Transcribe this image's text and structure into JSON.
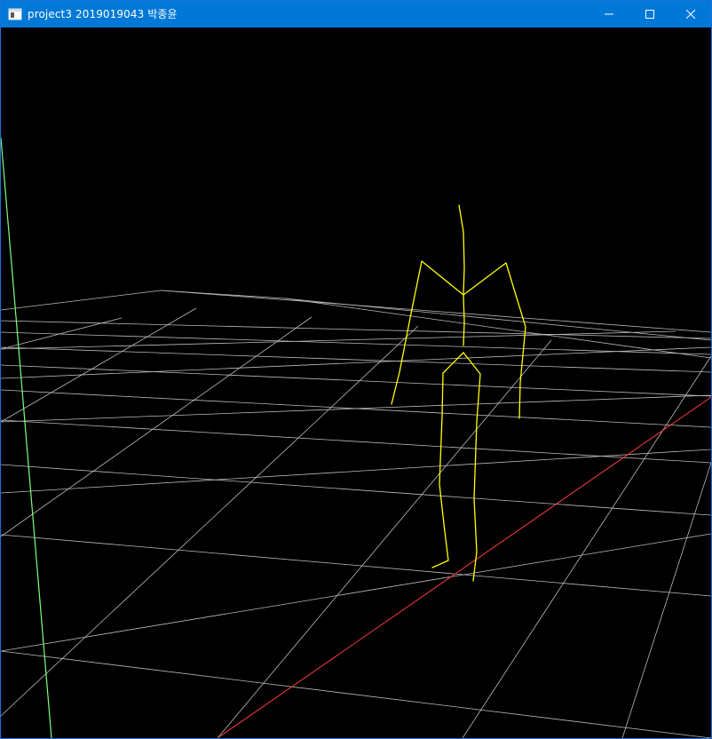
{
  "window": {
    "title": "project3 2019019043 박종윤",
    "controls": {
      "minimize_icon": "minimize-icon",
      "maximize_icon": "maximize-icon",
      "close_icon": "close-icon"
    },
    "colors": {
      "titlebar": "#0078d7",
      "background": "#000000",
      "grid": "#cfcfcf",
      "x_axis": "#ff3b3b",
      "y_axis": "#7dff7d",
      "skeleton": "#ffff00"
    }
  },
  "scene": {
    "grid": "ground-grid",
    "axes": [
      "x-axis",
      "y-axis"
    ],
    "skeleton": "stick-figure-skeleton"
  }
}
